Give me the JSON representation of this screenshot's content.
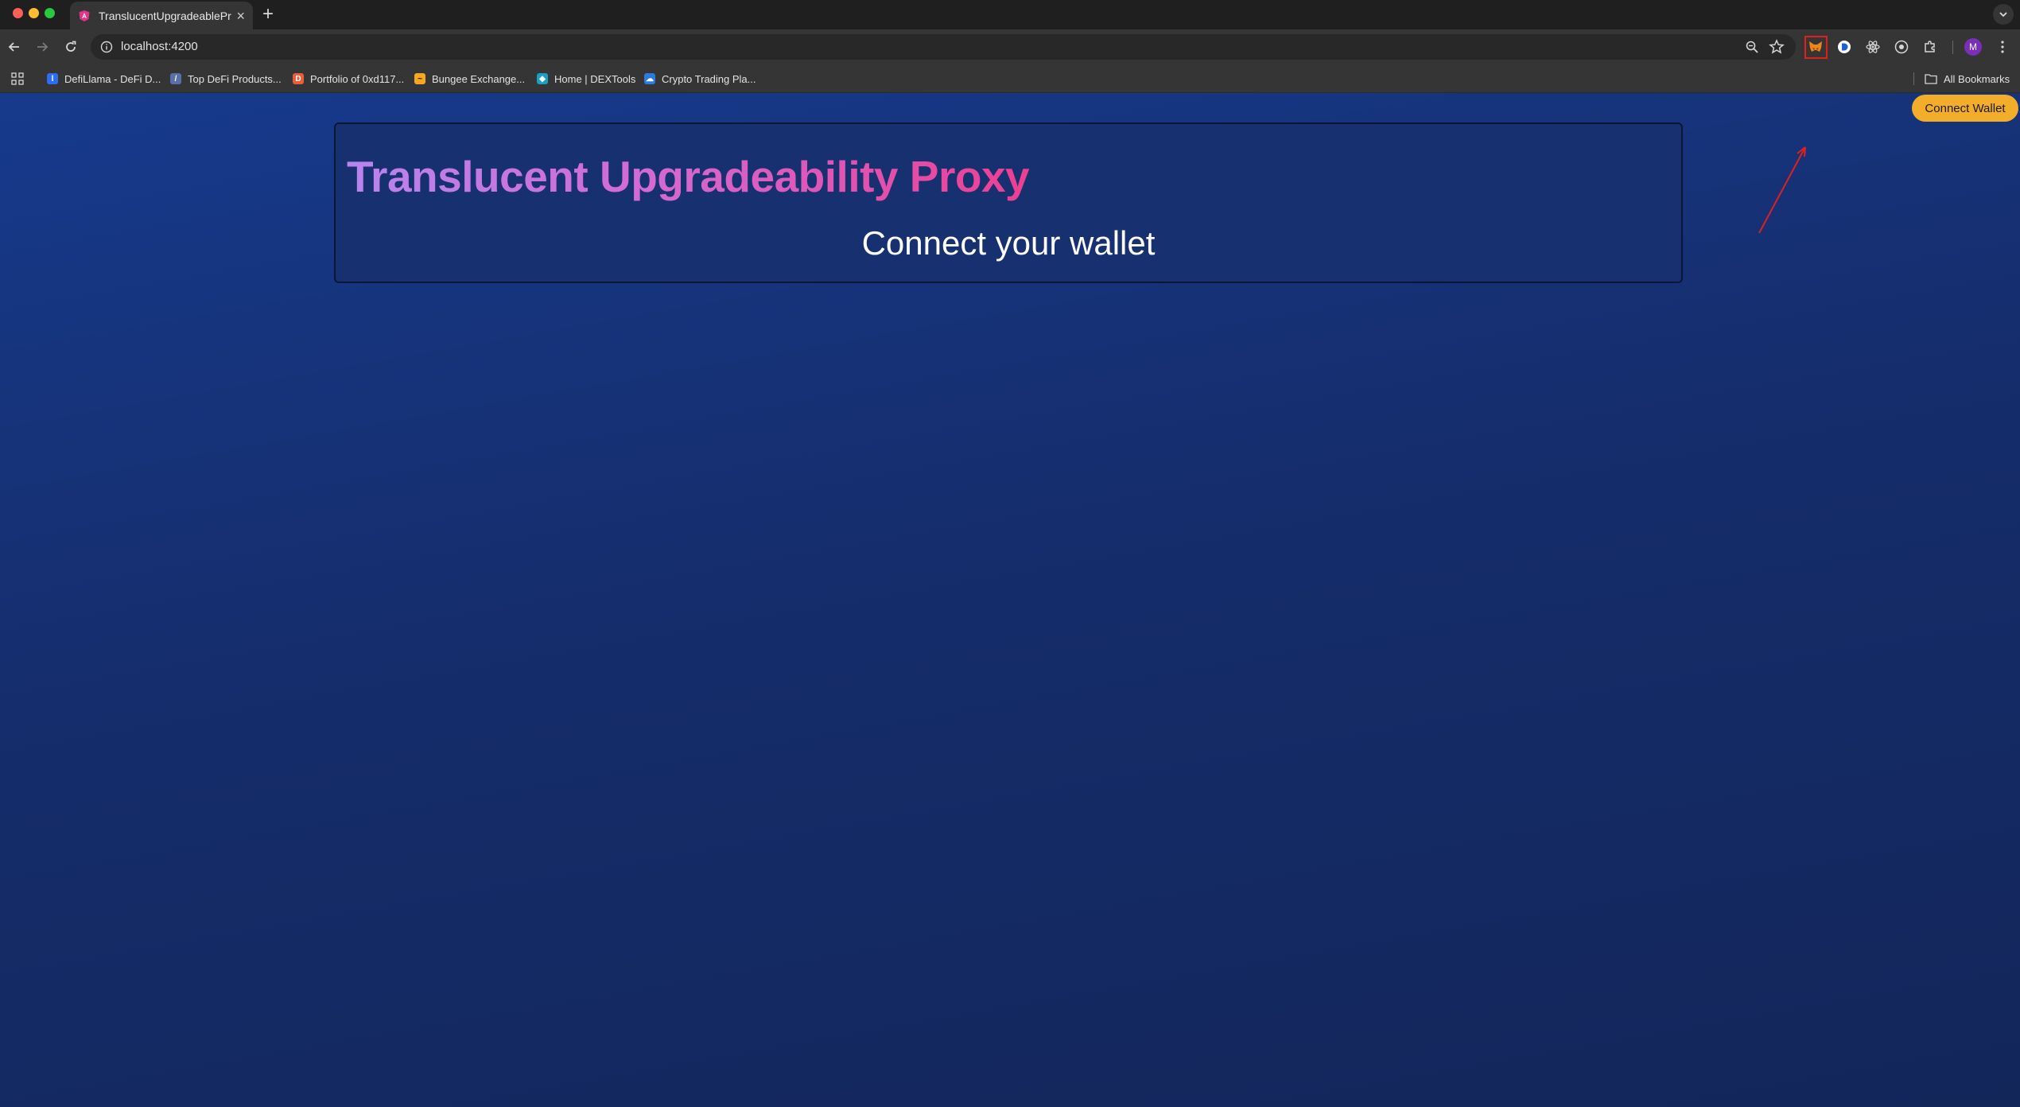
{
  "browser": {
    "tab_title": "TranslucentUpgradeableProxy",
    "url": "localhost:4200",
    "profile_initial": "M",
    "bookmarks": [
      {
        "label": "DefiLlama - DeFi D...",
        "color": "#2e6cf6",
        "icon": "defillama-icon"
      },
      {
        "label": "Top DeFi Products...",
        "color": "#5a6ea8",
        "icon": "defipulse-icon"
      },
      {
        "label": "Portfolio of 0xd117...",
        "color": "#e85d3a",
        "icon": "debank-icon"
      },
      {
        "label": "Bungee Exchange...",
        "color": "#f5a623",
        "icon": "bungee-icon"
      },
      {
        "label": "Home | DEXTools",
        "color": "#16a0c7",
        "icon": "dextools-icon"
      },
      {
        "label": "Crypto Trading Pla...",
        "color": "#2b7bd8",
        "icon": "crypto-platform-icon"
      }
    ],
    "all_bookmarks_label": "All Bookmarks"
  },
  "page": {
    "connect_wallet_button": "Connect Wallet",
    "title": "Translucent Upgradeability Proxy",
    "subtitle": "Connect your wallet"
  },
  "colors": {
    "accent_button": "#f2ad2a",
    "background": "#17306e",
    "title_gradient_start": "#b884ee",
    "title_gradient_end": "#ec3f92",
    "annotation": "#e0201c"
  }
}
